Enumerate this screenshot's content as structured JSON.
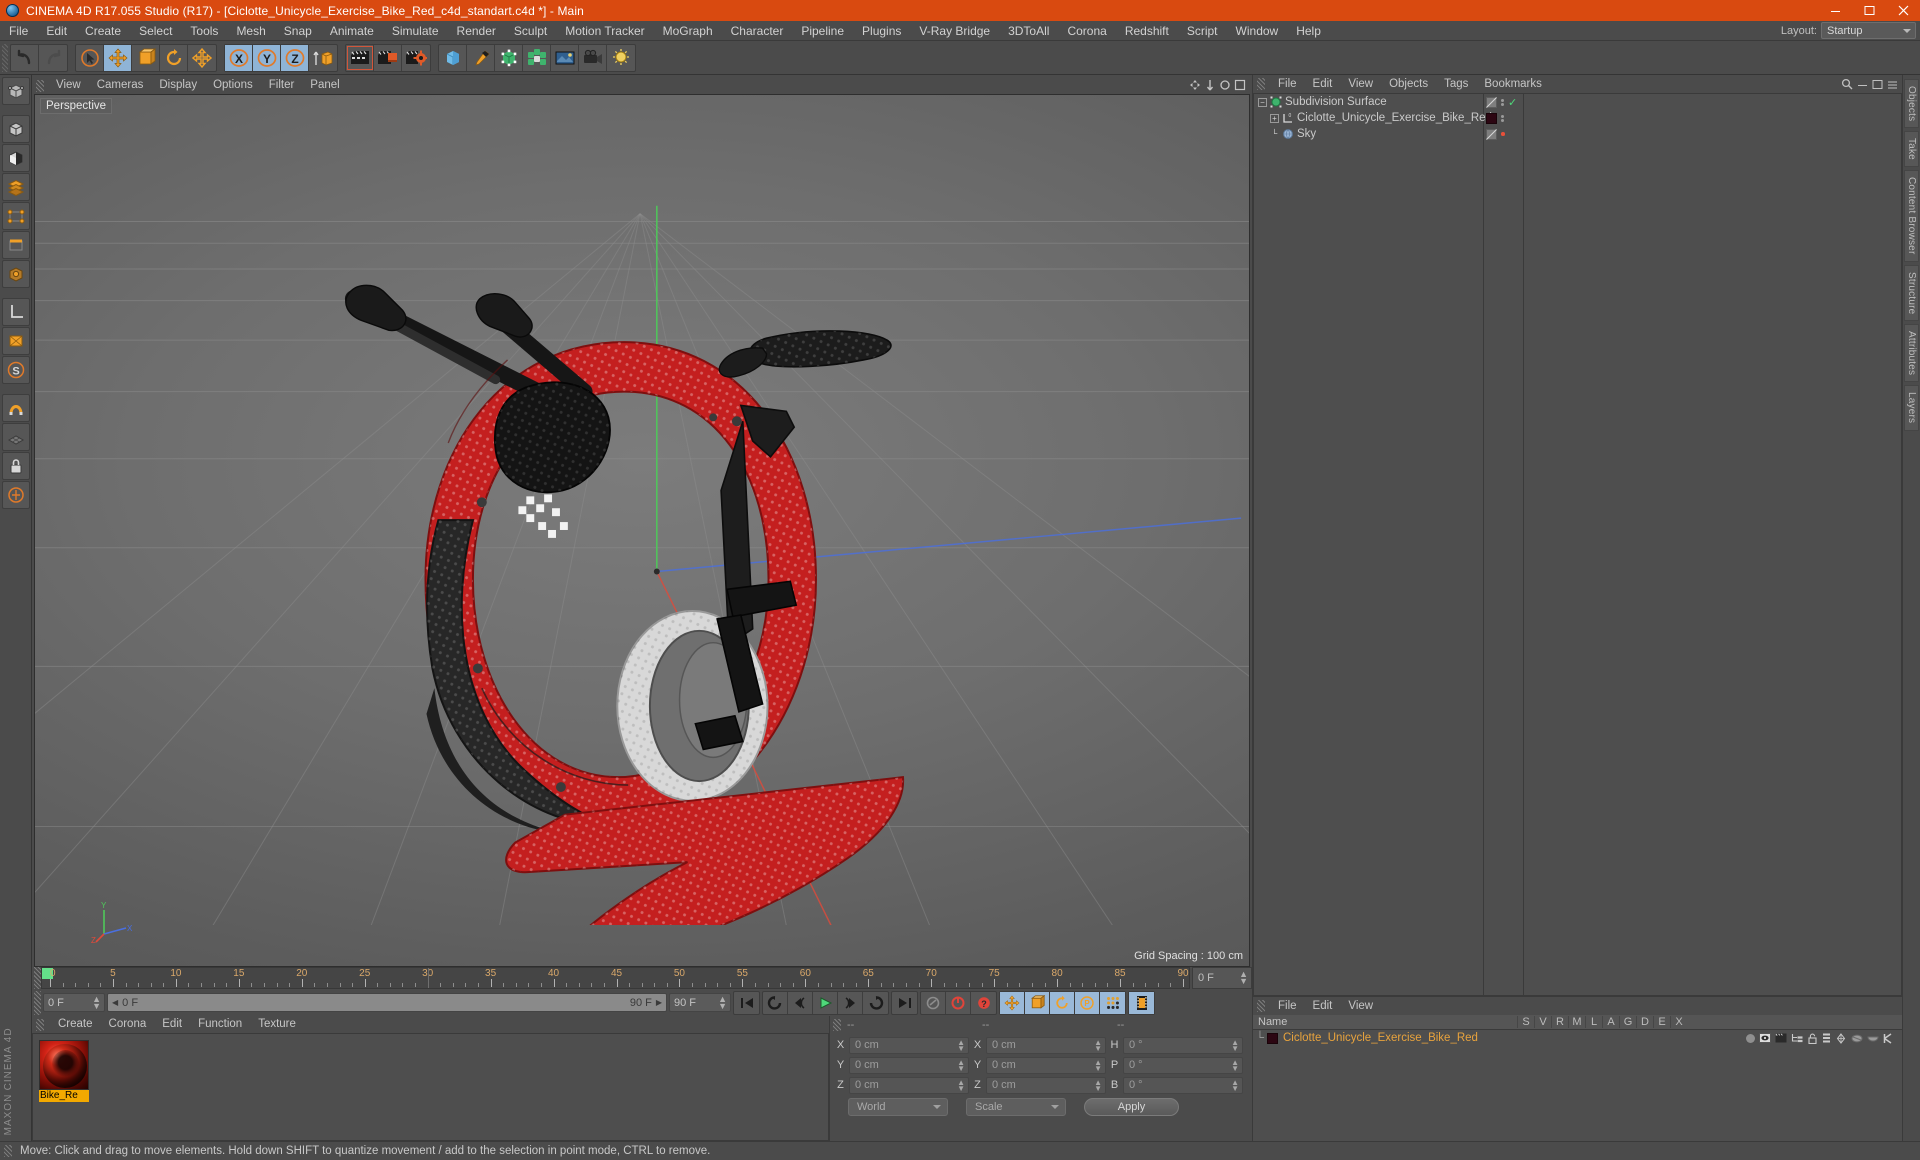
{
  "window": {
    "title": "CINEMA 4D R17.055 Studio (R17) - [Ciclotte_Unicycle_Exercise_Bike_Red_c4d_standart.c4d *] - Main",
    "app_icon": "c4d-logo-icon",
    "minimize": "minimize-icon",
    "maximize": "maximize-icon",
    "close": "close-icon"
  },
  "menubar": {
    "items": [
      "File",
      "Edit",
      "Create",
      "Select",
      "Tools",
      "Mesh",
      "Snap",
      "Animate",
      "Simulate",
      "Render",
      "Sculpt",
      "Motion Tracker",
      "MoGraph",
      "Character",
      "Pipeline",
      "Plugins",
      "V-Ray Bridge",
      "3DToAll",
      "Corona",
      "Redshift",
      "Script",
      "Window",
      "Help"
    ],
    "layout_label": "Layout:",
    "layout_value": "Startup"
  },
  "toolbar": {
    "groups": [
      {
        "name": "undo-redo",
        "cells": [
          {
            "name": "undo-button",
            "icon": "undo-arrow-icon",
            "state": "normal"
          },
          {
            "name": "redo-button",
            "icon": "redo-arrow-icon",
            "state": "disabled"
          }
        ]
      },
      {
        "name": "transform-tools",
        "cells": [
          {
            "name": "select-tool",
            "icon": "cursor-circle-icon",
            "state": "normal"
          },
          {
            "name": "move-tool",
            "icon": "move-cross-icon",
            "state": "active"
          },
          {
            "name": "scale-tool",
            "icon": "scale-box-icon",
            "state": "normal"
          },
          {
            "name": "rotate-tool",
            "icon": "rotate-arc-icon",
            "state": "normal"
          },
          {
            "name": "move-alt-tool",
            "icon": "move-cross-icon",
            "state": "normal"
          }
        ]
      },
      {
        "name": "axis-locks",
        "cells": [
          {
            "name": "x-axis-lock",
            "icon": "x-axis-icon",
            "state": "active",
            "label": "X"
          },
          {
            "name": "y-axis-lock",
            "icon": "y-axis-icon",
            "state": "active",
            "label": "Y"
          },
          {
            "name": "z-axis-lock",
            "icon": "z-axis-icon",
            "state": "active",
            "label": "Z"
          },
          {
            "name": "world-object-toggle",
            "icon": "world-coordinate-icon",
            "state": "normal"
          }
        ]
      },
      {
        "name": "render-tools",
        "cells": [
          {
            "name": "render-view",
            "icon": "render-clapper-icon",
            "state": "selected"
          },
          {
            "name": "render-to-picture-viewer",
            "icon": "render-picture-icon",
            "state": "normal"
          },
          {
            "name": "render-settings",
            "icon": "render-gear-icon",
            "state": "normal"
          }
        ]
      },
      {
        "name": "create-objects",
        "cells": [
          {
            "name": "add-cube-object",
            "icon": "cube-icon",
            "state": "normal"
          },
          {
            "name": "add-spline",
            "icon": "pen-spline-icon",
            "state": "normal"
          },
          {
            "name": "add-generator",
            "icon": "generator-icon",
            "state": "normal"
          },
          {
            "name": "add-deformer",
            "icon": "deformer-icon",
            "state": "normal"
          },
          {
            "name": "add-environment",
            "icon": "environment-icon",
            "state": "normal"
          },
          {
            "name": "add-camera",
            "icon": "camera-icon",
            "state": "normal"
          },
          {
            "name": "add-light",
            "icon": "light-bulb-icon",
            "state": "normal"
          }
        ]
      }
    ]
  },
  "leftbar": {
    "groups": [
      [
        {
          "name": "make-editable",
          "icon": "make-editable-icon"
        }
      ],
      [
        {
          "name": "model-mode",
          "icon": "model-mode-icon"
        },
        {
          "name": "texture-mode",
          "icon": "texture-checker-icon"
        },
        {
          "name": "polygon-mode",
          "icon": "polygon-layers-icon"
        },
        {
          "name": "point-mode",
          "icon": "point-mode-icon"
        },
        {
          "name": "edge-mode",
          "icon": "edge-mode-icon"
        },
        {
          "name": "object-axis-mode",
          "icon": "object-axis-icon"
        }
      ],
      [
        {
          "name": "viewport-solo",
          "icon": "l-shape-icon"
        },
        {
          "name": "texture-axis-lock",
          "icon": "texture-axis-icon"
        },
        {
          "name": "quantize-toggle",
          "icon": "quantize-s-icon"
        }
      ],
      [
        {
          "name": "snap-toggle",
          "icon": "magnet-snap-icon"
        },
        {
          "name": "workplane-toggle",
          "icon": "workplane-grid-icon"
        },
        {
          "name": "lock-workplane",
          "icon": "lock-icon"
        },
        {
          "name": "enable-axis",
          "icon": "axis-enable-icon"
        }
      ]
    ],
    "brand_line1": "MAXON",
    "brand_line2": "CINEMA 4D"
  },
  "viewport": {
    "menu": [
      "View",
      "Cameras",
      "Display",
      "Options",
      "Filter",
      "Panel"
    ],
    "label": "Perspective",
    "grid_spacing": "Grid Spacing : 100 cm",
    "axis_labels": {
      "y": "Y",
      "x": "X",
      "z": "Z"
    },
    "icons": [
      "viewport-move-icon",
      "viewport-zoom-icon",
      "viewport-rotate-icon",
      "viewport-maximize-icon"
    ]
  },
  "timeline": {
    "ticks": [
      0,
      5,
      10,
      15,
      20,
      25,
      30,
      35,
      40,
      45,
      50,
      55,
      60,
      65,
      70,
      75,
      80,
      85,
      90
    ],
    "current_frame_marker": 0,
    "end_frame_field": "0 F"
  },
  "transport": {
    "current_frame": "0 F",
    "range_start": "0 F",
    "range_end": "90 F",
    "preview_end": "90 F",
    "buttons": [
      {
        "name": "go-to-start-button",
        "icon": "skip-start-icon"
      },
      {
        "name": "play-reverse-button",
        "icon": "rewind-loop-icon"
      },
      {
        "name": "step-back-button",
        "icon": "step-back-icon"
      },
      {
        "name": "play-button",
        "icon": "play-triangle-icon"
      },
      {
        "name": "step-forward-button",
        "icon": "step-forward-icon"
      },
      {
        "name": "loop-button",
        "icon": "loop-arrow-icon"
      },
      {
        "name": "go-to-end-button",
        "icon": "skip-end-icon"
      },
      {
        "name": "record-active-objects-button",
        "icon": "key-record-icon"
      },
      {
        "name": "autokeying-button",
        "icon": "autokey-circle-icon"
      },
      {
        "name": "keyframe-selection-button",
        "icon": "question-key-icon"
      },
      {
        "name": "record-position-toggle",
        "icon": "move-cross-icon"
      },
      {
        "name": "record-scale-toggle",
        "icon": "scale-box-icon"
      },
      {
        "name": "record-rotation-toggle",
        "icon": "rotate-arc-icon"
      },
      {
        "name": "record-parameter-toggle",
        "icon": "p-circle-icon"
      },
      {
        "name": "point-level-animation-toggle",
        "icon": "pla-dots-icon"
      },
      {
        "name": "timeline-toggle",
        "icon": "film-strip-icon"
      }
    ]
  },
  "material_manager_bottom": {
    "menu": [
      "Create",
      "Corona",
      "Edit",
      "Function",
      "Texture"
    ],
    "materials": [
      {
        "name": "Bike_Red",
        "display_name": "Bike_Re",
        "icon": "material-sphere-icon",
        "selected": true
      }
    ]
  },
  "coordinates": {
    "headers": [
      "--",
      "--",
      "--"
    ],
    "rows": [
      {
        "pos_axis": "X",
        "pos_value": "0 cm",
        "size_axis": "X",
        "size_value": "0 cm",
        "rot_axis": "H",
        "rot_value": "0 °"
      },
      {
        "pos_axis": "Y",
        "pos_value": "0 cm",
        "size_axis": "Y",
        "size_value": "0 cm",
        "rot_axis": "P",
        "rot_value": "0 °"
      },
      {
        "pos_axis": "Z",
        "pos_value": "0 cm",
        "size_axis": "Z",
        "size_value": "0 cm",
        "rot_axis": "B",
        "rot_value": "0 °"
      }
    ],
    "system_select": "World",
    "mode_select": "Scale",
    "apply_label": "Apply"
  },
  "object_manager": {
    "menu": [
      "File",
      "Edit",
      "View",
      "Objects",
      "Tags",
      "Bookmarks"
    ],
    "objects": [
      {
        "name": "Subdivision Surface",
        "icon": "subdivision-surface-icon",
        "depth": 0,
        "expandable": true,
        "visible_dot_top": "gray",
        "visible_dot_bottom": "gray",
        "check": true
      },
      {
        "name": "Ciclotte_Unicycle_Exercise_Bike_Red",
        "icon": "polygon-object-icon",
        "depth": 1,
        "expandable": true,
        "tag_color": "#2c0612"
      },
      {
        "name": "Sky",
        "icon": "sky-object-icon",
        "depth": 1,
        "expandable": false,
        "dot_color": "#e8503a"
      }
    ]
  },
  "material_manager_right": {
    "menu": [
      "File",
      "Edit",
      "View"
    ],
    "columns": [
      "Name",
      "S",
      "V",
      "R",
      "M",
      "L",
      "A",
      "G",
      "D",
      "E",
      "X"
    ],
    "rows": [
      {
        "name": "Ciclotte_Unicycle_Exercise_Bike_Red",
        "swatch": "#2c0612"
      }
    ]
  },
  "right_tabs": [
    "Objects",
    "Take",
    "Content Browser",
    "Structure",
    "Attributes",
    "Layers"
  ],
  "statusbar": {
    "message": "Move: Click and drag to move elements. Hold down SHIFT to quantize movement / add to the selection in point mode, CTRL to remove."
  },
  "colors": {
    "title_bar": "#d94a10",
    "panel_bg": "#4b4b4b",
    "accent_orange": "#e8a33d",
    "active_blue": "#8fb4d6",
    "playhead_green": "#64e08a",
    "material_yellow": "#f2a900"
  }
}
